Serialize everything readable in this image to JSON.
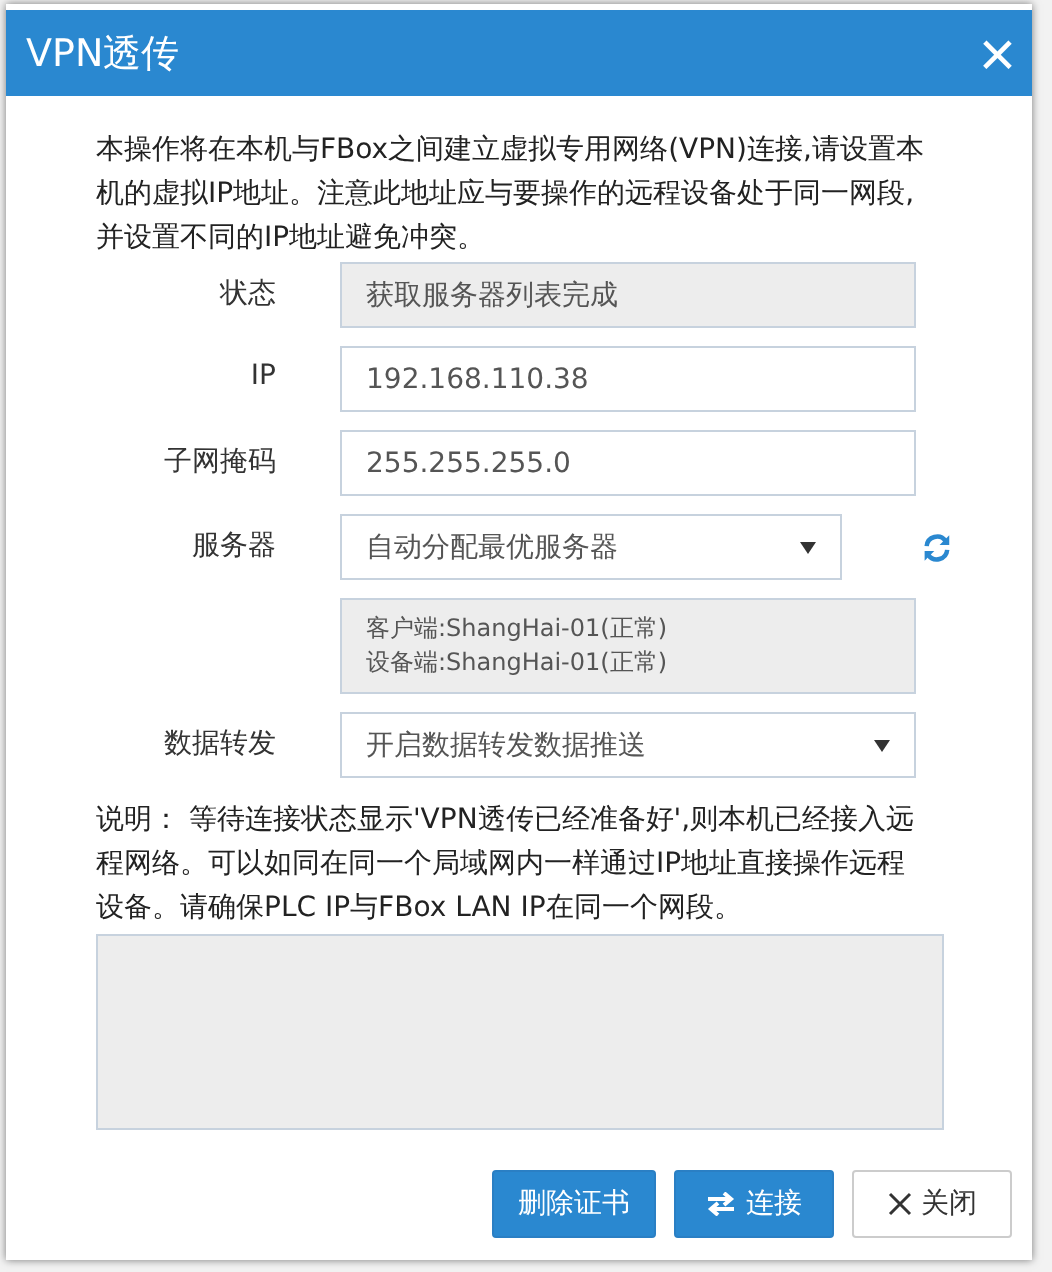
{
  "window": {
    "title": "VPN透传",
    "close": "×"
  },
  "intro": "本操作将在本机与FBox之间建立虚拟专用网络(VPN)连接,请设置本机的虚拟IP地址。注意此地址应与要操作的远程设备处于同一网段,并设置不同的IP地址避免冲突。",
  "fields": [
    {
      "kind": "readonly",
      "label": "状态",
      "value": "获取服务器列表完成"
    },
    {
      "kind": "input",
      "label": "IP",
      "value": "192.168.110.38"
    },
    {
      "kind": "input",
      "label": "子网掩码",
      "value": "255.255.255.0"
    },
    {
      "kind": "select-refresh",
      "label": "服务器",
      "value": "自动分配最优服务器"
    },
    {
      "kind": "info",
      "lines": [
        "客户端:ShangHai-01(正常)",
        "设备端:ShangHai-01(正常)"
      ]
    },
    {
      "kind": "select",
      "label": "数据转发",
      "value": "开启数据转发数据推送"
    }
  ],
  "description": "说明：  等待连接状态显示'VPN透传已经准备好',则本机已经接入远程网络。可以如同在同一个局域网内一样通过IP地址直接操作远程设备。请确保PLC IP与FBox LAN IP在同一个网段。",
  "buttons": [
    {
      "kind": "primary",
      "label": "删除证书"
    },
    {
      "kind": "primary-connect",
      "label": "连接"
    },
    {
      "kind": "default-close",
      "label": "关闭"
    }
  ]
}
